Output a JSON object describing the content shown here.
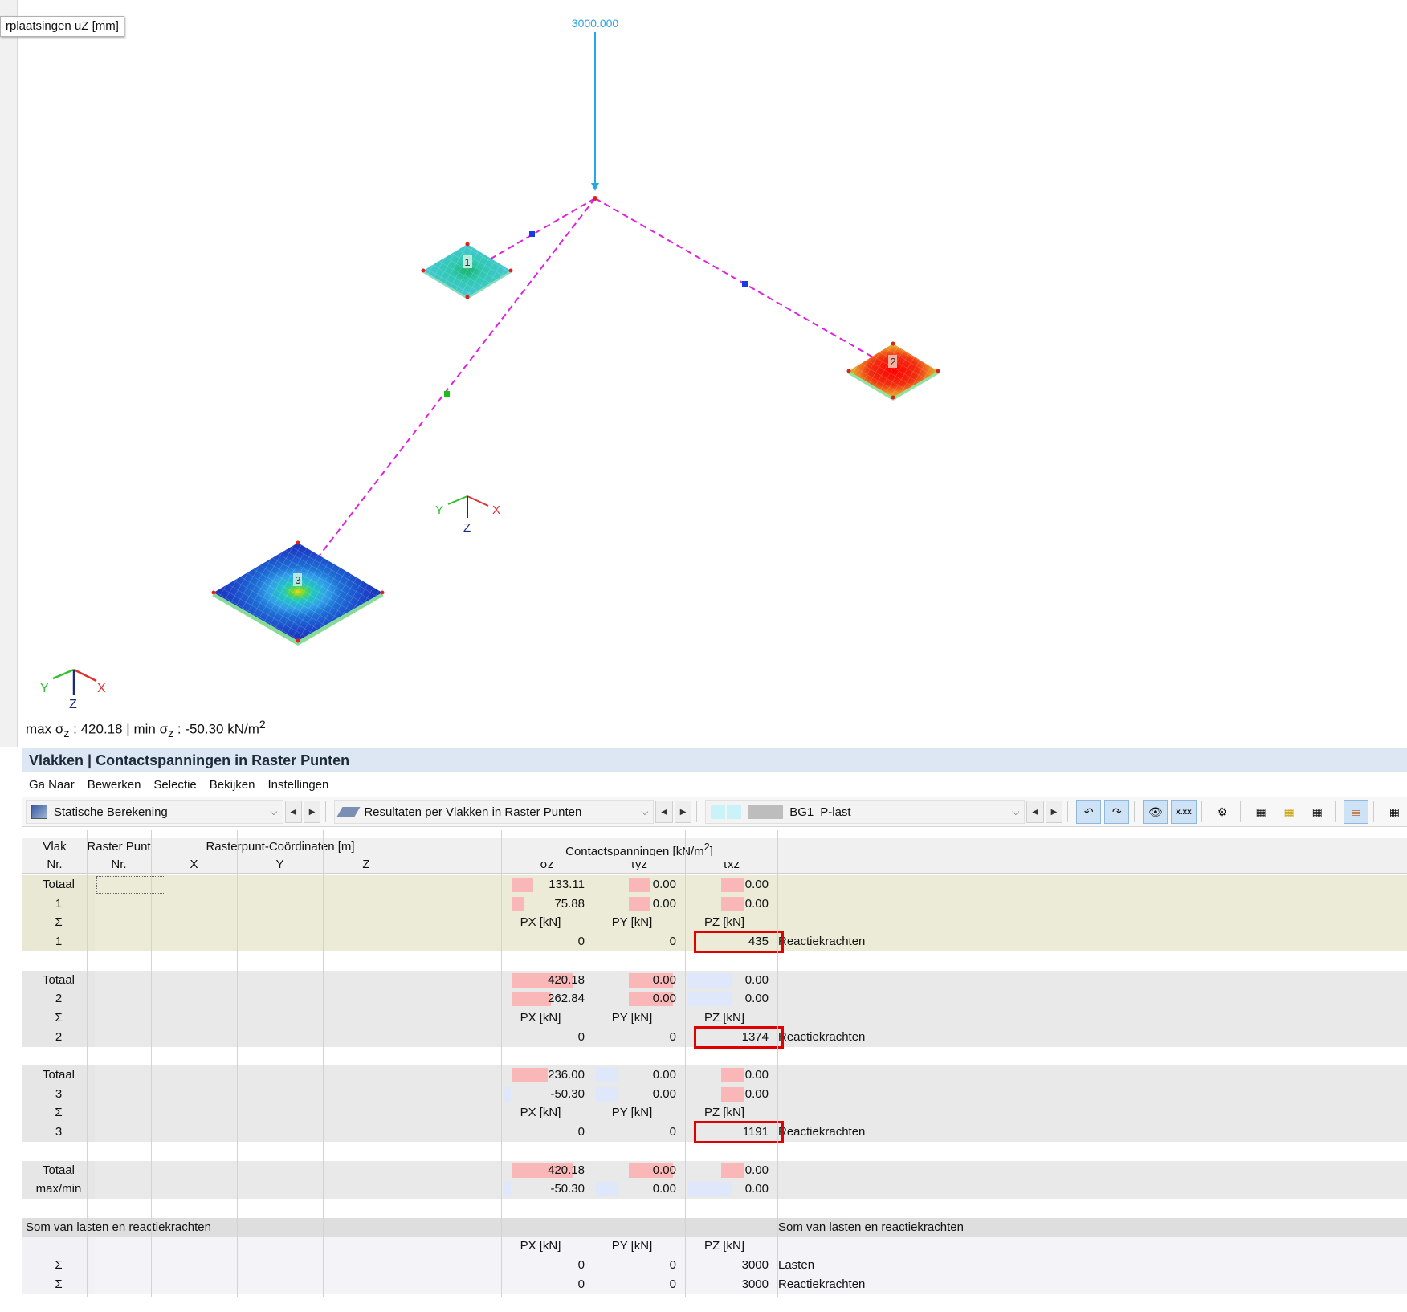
{
  "viewport": {
    "result_tag": "rplaatsingen uZ  [mm]",
    "load_label": "3000.000",
    "node_labels": [
      "1",
      "2",
      "3"
    ],
    "axes": {
      "x": "X",
      "y": "Y",
      "z": "Z"
    },
    "maxmin_prefix": "max σ",
    "maxmin_sub1": "z",
    "maxmin_mid": " : 420.18 | min σ",
    "maxmin_sub2": "z",
    "maxmin_suffix": " : -50.30 kN/m",
    "maxmin_sup": "2"
  },
  "panel": {
    "title": "Vlakken | Contactspanningen in Raster Punten",
    "menu": [
      "Ga Naar",
      "Bewerken",
      "Selectie",
      "Bekijken",
      "Instellingen"
    ],
    "toolbar": {
      "analysis": "Statische Berekening",
      "results": "Resultaten per Vlakken in Raster Punten",
      "lc_code": "BG1",
      "lc_name": "P-last"
    }
  },
  "table": {
    "headers": {
      "vlak_1": "Vlak",
      "vlak_2": "Nr.",
      "raster_1": "Raster Punt",
      "raster_2": "Nr.",
      "coords": "Rasterpunt-Coördinaten [m]",
      "x": "X",
      "y": "Y",
      "z": "Z",
      "contact": "Contactspanningen [kN/m",
      "contact_sup": "2",
      "contact_end": "]",
      "sigma": "σz",
      "tau_yz": "τyz",
      "tau_xz": "τxz"
    },
    "groups": [
      {
        "style": "beige",
        "rows": [
          {
            "nr": "Totaal",
            "sz": "133.11",
            "tyz": "0.00",
            "txz": "0.00"
          },
          {
            "nr": "1",
            "sz": "75.88",
            "tyz": "0.00",
            "txz": "0.00"
          }
        ],
        "units": {
          "nr": "Σ",
          "px": "PX [kN]",
          "py": "PY [kN]",
          "pz": "PZ [kN]"
        },
        "reaction": {
          "nr": "1",
          "px": "0",
          "py": "0",
          "pz": "435",
          "label": "Reactiekrachten"
        }
      },
      {
        "style": "grey",
        "rows": [
          {
            "nr": "Totaal",
            "sz": "420.18",
            "tyz": "0.00",
            "txz": "0.00"
          },
          {
            "nr": "2",
            "sz": "262.84",
            "tyz": "0.00",
            "txz": "0.00"
          }
        ],
        "units": {
          "nr": "Σ",
          "px": "PX [kN]",
          "py": "PY [kN]",
          "pz": "PZ [kN]"
        },
        "reaction": {
          "nr": "2",
          "px": "0",
          "py": "0",
          "pz": "1374",
          "label": "Reactiekrachten"
        }
      },
      {
        "style": "grey",
        "rows": [
          {
            "nr": "Totaal",
            "sz": "236.00",
            "tyz": "0.00",
            "txz": "0.00"
          },
          {
            "nr": "3",
            "sz": "-50.30",
            "tyz": "0.00",
            "txz": "0.00"
          }
        ],
        "units": {
          "nr": "Σ",
          "px": "PX [kN]",
          "py": "PY [kN]",
          "pz": "PZ [kN]"
        },
        "reaction": {
          "nr": "3",
          "px": "0",
          "py": "0",
          "pz": "1191",
          "label": "Reactiekrachten"
        }
      }
    ],
    "total_rows": [
      {
        "nr": "Totaal",
        "sz": "420.18",
        "tyz": "0.00",
        "txz": "0.00"
      },
      {
        "nr": "max/min",
        "sz": "-50.30",
        "tyz": "0.00",
        "txz": "0.00"
      }
    ],
    "summary": {
      "title_left": "Som van lasten en reactiekrachten",
      "title_right": "Som van lasten en reactiekrachten",
      "units": {
        "px": "PX [kN]",
        "py": "PY [kN]",
        "pz": "PZ [kN]"
      },
      "rows": [
        {
          "nr": "Σ",
          "px": "0",
          "py": "0",
          "pz": "3000",
          "label": "Lasten"
        },
        {
          "nr": "Σ",
          "px": "0",
          "py": "0",
          "pz": "3000",
          "label": "Reactiekrachten"
        }
      ]
    }
  },
  "colors": {
    "load_arrow": "#29a6e6",
    "rigid_link": "#e020e0",
    "highlight": "#e00000",
    "bar_pink": "#f9b7b7",
    "bar_blue": "#dfe7fb"
  }
}
